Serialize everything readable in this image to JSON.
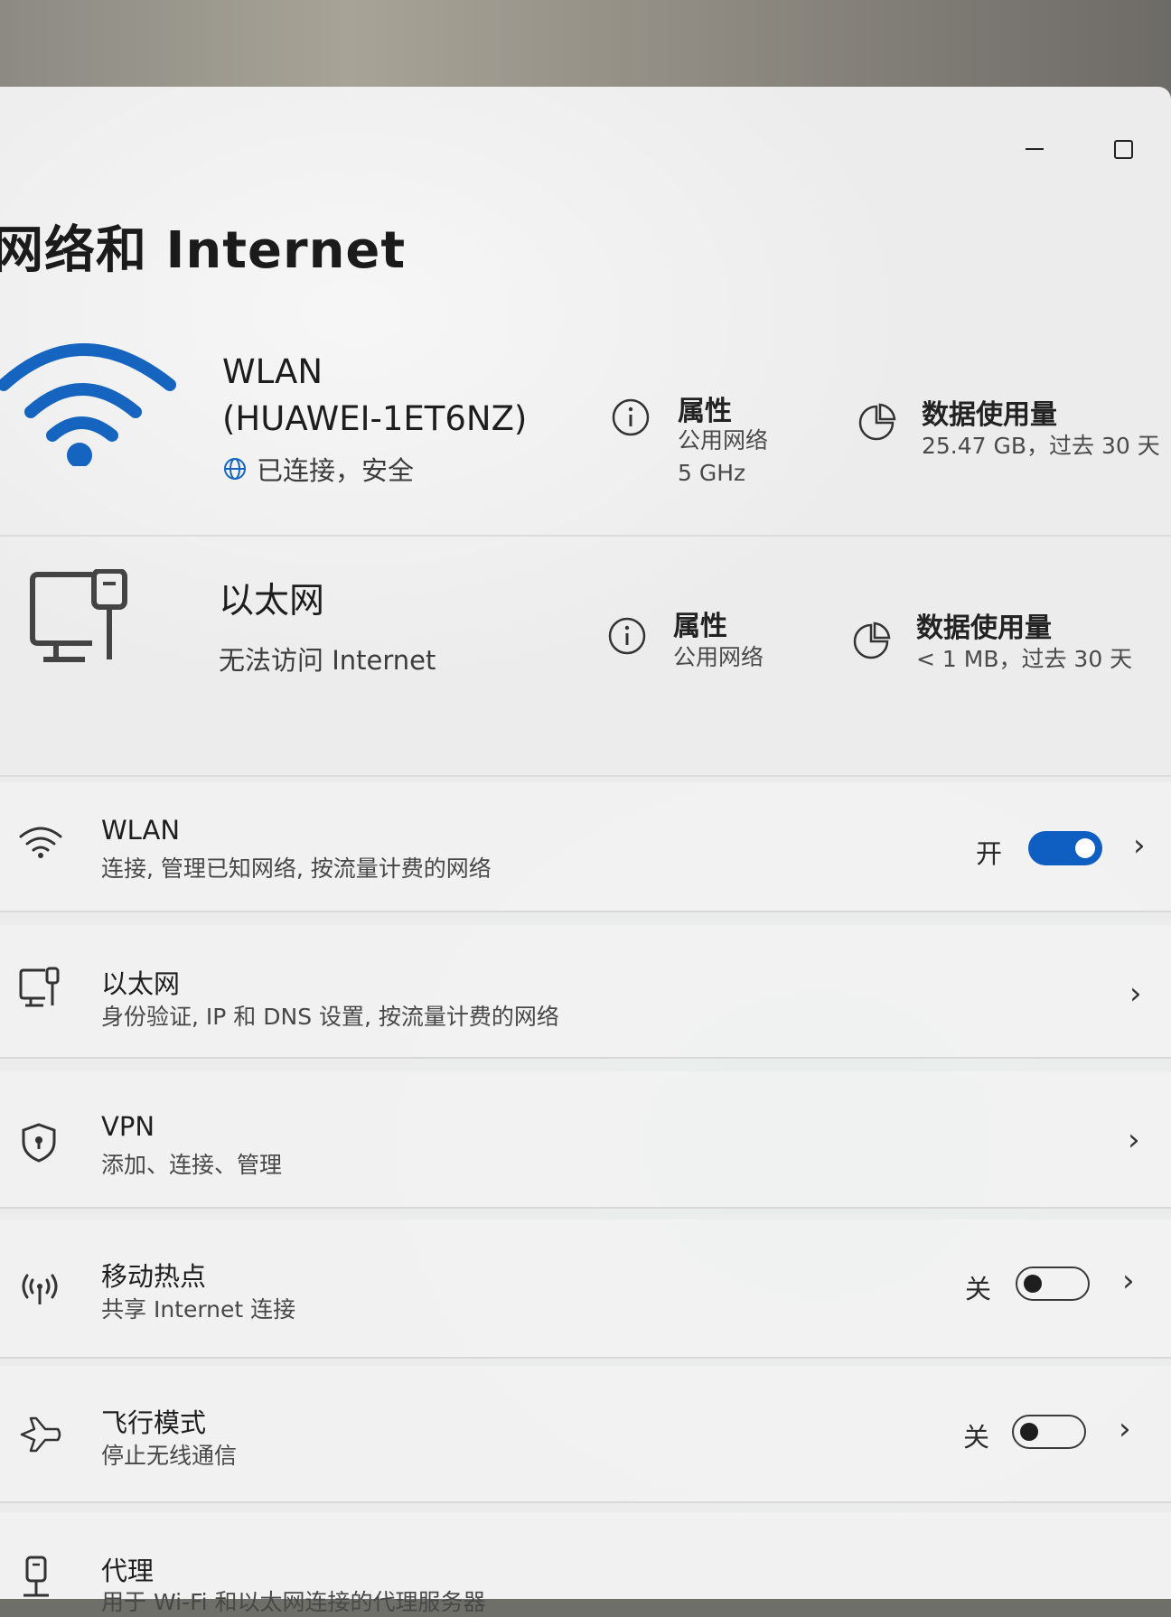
{
  "window": {
    "title": "网络和 Internet"
  },
  "wifi_card": {
    "name_line1": "WLAN",
    "name_line2": "(HUAWEI-1ET6NZ)",
    "status": "已连接，安全",
    "properties_title": "属性",
    "properties_line1": "公用网络",
    "properties_line2": "5 GHz",
    "usage_title": "数据使用量",
    "usage_value": "25.47 GB，过去 30 天"
  },
  "ethernet_card": {
    "name": "以太网",
    "status": "无法访问 Internet",
    "properties_title": "属性",
    "properties_line1": "公用网络",
    "usage_title": "数据使用量",
    "usage_value": "< 1 MB，过去 30 天"
  },
  "settings_rows": [
    {
      "title": "WLAN",
      "subtitle": "连接, 管理已知网络, 按流量计费的网络",
      "state": "开",
      "toggle_on": true
    },
    {
      "title": "以太网",
      "subtitle": "身份验证, IP 和 DNS 设置, 按流量计费的网络"
    },
    {
      "title": "VPN",
      "subtitle": "添加、连接、管理"
    },
    {
      "title": "移动热点",
      "subtitle": "共享 Internet 连接",
      "state": "关",
      "toggle_on": false
    },
    {
      "title": "飞行模式",
      "subtitle": "停止无线通信",
      "state": "关",
      "toggle_on": false
    },
    {
      "title": "代理",
      "subtitle": "用于 Wi-Fi 和以太网连接的代理服务器"
    }
  ],
  "icons": {
    "wifi_large": "wifi-icon",
    "ethernet_large": "ethernet-icon",
    "info": "info-icon",
    "data_usage": "pie-chart-icon",
    "globe": "globe-icon",
    "vpn": "shield-icon",
    "hotspot": "hotspot-icon",
    "airplane": "airplane-icon",
    "proxy": "proxy-icon",
    "chevron": "chevron-right-icon"
  },
  "colors": {
    "accent": "#0f5ec2",
    "wifi_icon": "#1565c0"
  }
}
